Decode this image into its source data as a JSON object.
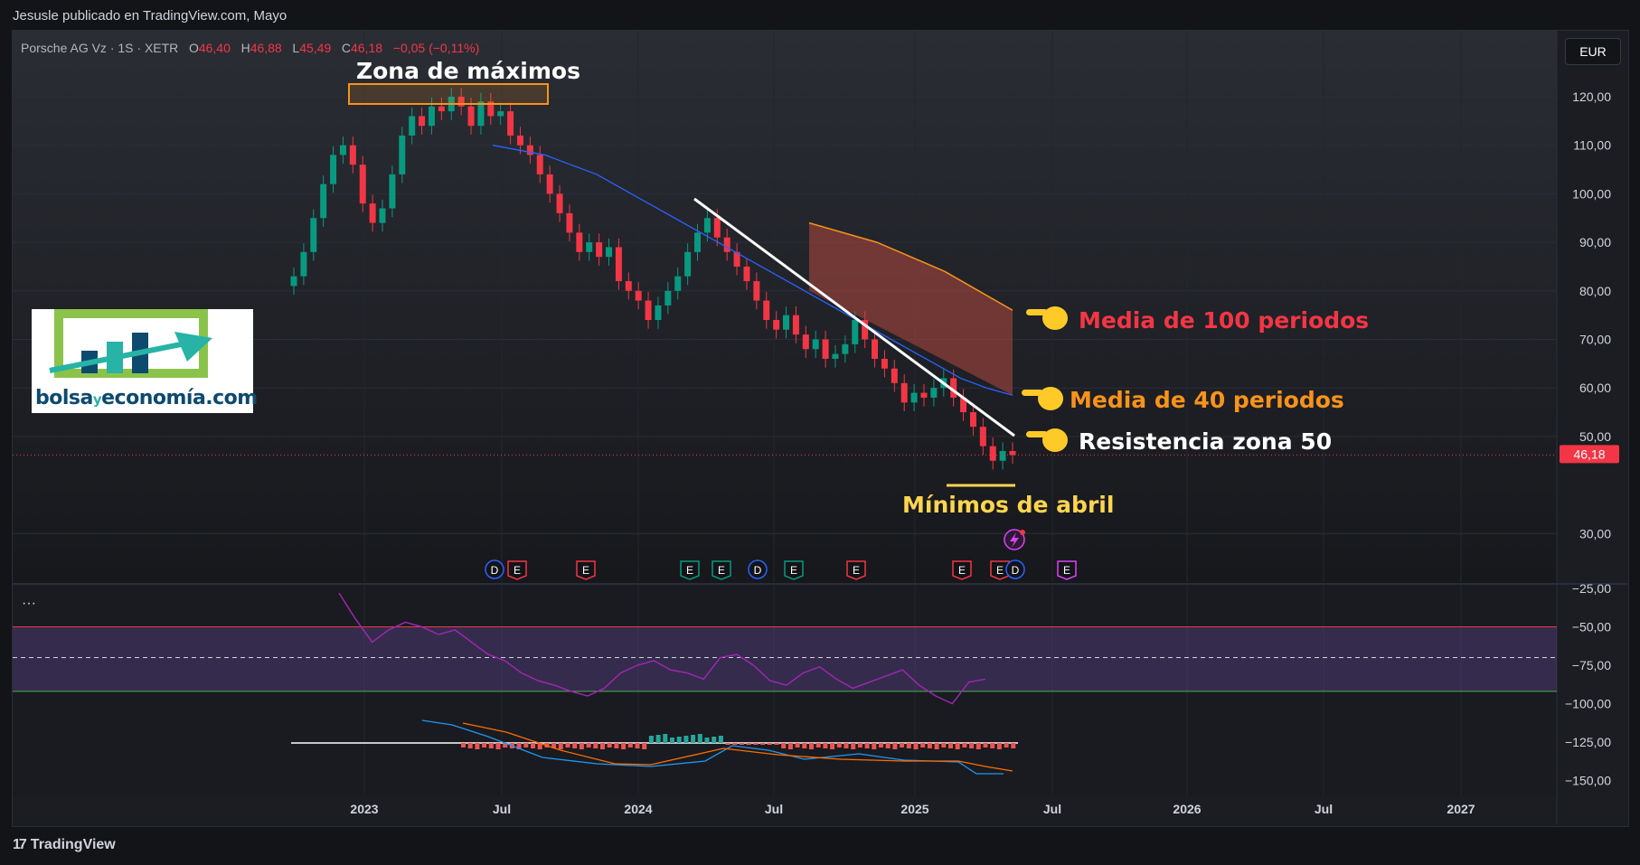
{
  "credit": "Jesusle publicado en TradingView.com, Mayo",
  "header": {
    "symbol": "Porsche AG Vz · 1S · XETR",
    "o_label": "O",
    "o": "46,40",
    "h_label": "H",
    "h": "46,88",
    "l_label": "L",
    "l": "45,49",
    "c_label": "C",
    "c": "46,18",
    "change": "−0,05 (−0,11%)"
  },
  "currency": "EUR",
  "annotations": {
    "zona_max": "Zona de máximos",
    "media100": "Media de 100 periodos",
    "media40": "Media de 40 periodos",
    "resistencia": "Resistencia zona 50",
    "minimos": "Mínimos de abril"
  },
  "logo": {
    "part1": "bolsa",
    "part2": "y",
    "part3": "economía.com"
  },
  "indicator_menu": "···",
  "footer": {
    "brand": "TradingView",
    "mark": "17"
  },
  "colors": {
    "up": "#089981",
    "down": "#f23645",
    "ma40": "#2962ff",
    "ma100": "#f7931a",
    "osc": "#9c27b0",
    "macd": "#2196f3",
    "signal": "#ff6d00",
    "annotation_red": "#f23645",
    "annotation_orange": "#f7931a",
    "annotation_yellow": "#ffd54f"
  },
  "events": [
    "D",
    "E",
    "E",
    "E",
    "E",
    "D",
    "E",
    "E",
    "E",
    "E",
    "D",
    "E"
  ],
  "chart_data": {
    "type": "candlestick",
    "interval": "1S",
    "price_axis": {
      "ticks": [
        120,
        110,
        100,
        90,
        80,
        70,
        60,
        50,
        30
      ],
      "tick_labels": [
        "120,00",
        "110,00",
        "100,00",
        "90,00",
        "80,00",
        "70,00",
        "60,00",
        "50,00",
        "30,00"
      ],
      "last_price_label": "46,18",
      "last_price": 46.18
    },
    "time_axis": {
      "labels": [
        "2023",
        "Jul",
        "2024",
        "Jul",
        "2025",
        "Jul",
        "2026",
        "Jul",
        "2027"
      ]
    },
    "series": [
      {
        "name": "Porsche AG Vz",
        "type": "candlestick",
        "close": [
          83,
          88,
          95,
          102,
          108,
          110,
          106,
          98,
          94,
          97,
          104,
          112,
          116,
          114,
          118,
          117,
          120,
          118,
          114,
          119,
          116,
          117,
          112,
          110,
          108,
          104,
          100,
          96,
          92,
          88,
          90,
          87,
          89,
          82,
          80,
          78,
          74,
          77,
          80,
          83,
          88,
          92,
          95,
          91,
          88,
          85,
          82,
          78,
          74,
          72,
          75,
          71,
          68,
          70,
          66,
          67,
          69,
          74,
          70,
          66,
          64,
          61,
          57,
          59,
          58,
          60,
          62,
          58,
          55,
          52,
          48,
          45,
          47,
          46.18
        ]
      },
      {
        "name": "Media de 40 periodos",
        "values": [
          110,
          109,
          108,
          106,
          104,
          101,
          98,
          95,
          92,
          89,
          86,
          83,
          80,
          77,
          74,
          71,
          68,
          65,
          62,
          60,
          58.5
        ]
      },
      {
        "name": "Media de 100 periodos",
        "values": [
          94,
          92,
          90,
          87,
          84,
          80,
          76
        ]
      },
      {
        "name": "Oscilador",
        "axis_ticks": [
          -25,
          -50,
          -75,
          -100,
          -125,
          -150
        ],
        "axis_labels": [
          "−25,00",
          "−50,00",
          "−75,00",
          "−100,00",
          "−125,00",
          "−150,00"
        ],
        "bands": [
          -50,
          -70,
          -92
        ],
        "values": [
          -28,
          -45,
          -60,
          -52,
          -47,
          -50,
          -55,
          -52,
          -60,
          -68,
          -72,
          -80,
          -85,
          -88,
          -92,
          -95,
          -90,
          -80,
          -75,
          -72,
          -78,
          -80,
          -84,
          -70,
          -68,
          -75,
          -85,
          -88,
          -80,
          -76,
          -84,
          -90,
          -86,
          -82,
          -78,
          -88,
          -95,
          -100,
          -86,
          -84
        ]
      }
    ]
  }
}
